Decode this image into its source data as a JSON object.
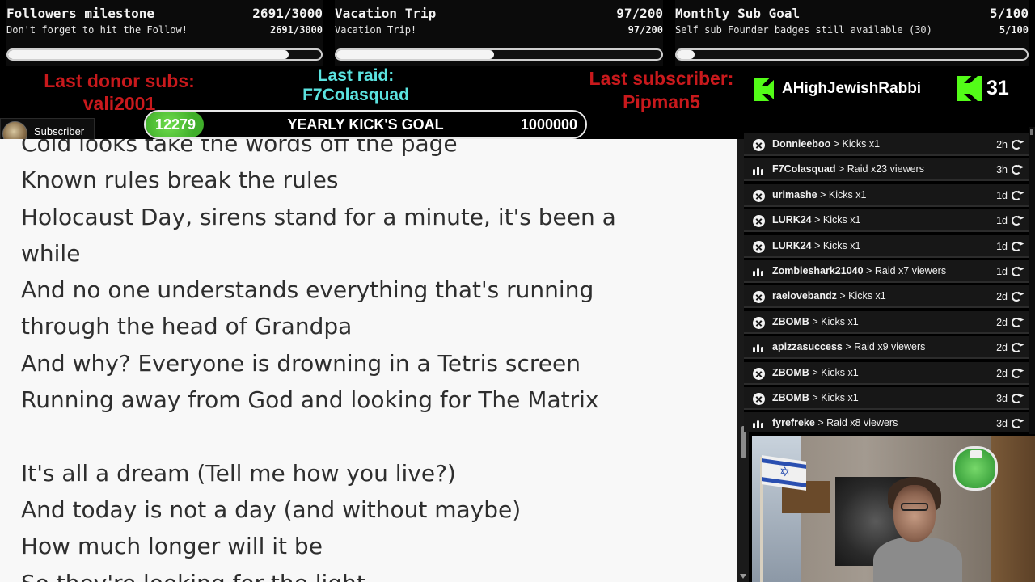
{
  "goals": [
    {
      "title": "Followers milestone",
      "count": "2691/3000",
      "subtitle": "Don't forget to hit the Follow!",
      "count_small": "2691/3000",
      "progress": 0.897
    },
    {
      "title": "Vacation Trip",
      "count": "97/200",
      "subtitle": "Vacation Trip!",
      "count_small": "97/200",
      "progress": 0.485
    },
    {
      "title": "Monthly Sub Goal",
      "count": "5/100",
      "subtitle": "Self sub Founder badges still available (30)",
      "count_small": "5/100",
      "progress": 0.05
    }
  ],
  "info": {
    "donor_title": "Last donor subs:",
    "donor_name": "vali2001",
    "raid_title": "Last raid:",
    "raid_name": "F7Colasquad",
    "subscriber_title": "Last subscriber:",
    "subscriber_name": "Pipman5",
    "latest_user": "AHighJewishRabbi",
    "kick_count": "31"
  },
  "yearly_goal": {
    "current": "12279",
    "title": "YEARLY KICK'S GOAL",
    "target": "1000000",
    "progress": 0.0123
  },
  "subscriber_badge": {
    "label": "Subscriber"
  },
  "lyrics": [
    "Cold looks take the words off the page",
    "Known rules break the rules",
    "Holocaust Day, sirens stand for a minute, it's been a",
    "while",
    "And no one understands everything that's running",
    "through the head of Grandpa",
    "And why? Everyone is drowning in a Tetris screen",
    "Running away from God and looking for The Matrix",
    "",
    "It's all a dream (Tell me how you live?)",
    "And today is not a day (and without maybe)",
    "How much longer will it be",
    "So they're looking for the light"
  ],
  "feed": [
    {
      "icon": "kick",
      "user": "Donnieeboo",
      "action": "Kicks x1",
      "time": "2h"
    },
    {
      "icon": "raid",
      "user": "F7Colasquad",
      "action": "Raid x23 viewers",
      "time": "3h"
    },
    {
      "icon": "kick",
      "user": "urimashe",
      "action": "Kicks x1",
      "time": "1d"
    },
    {
      "icon": "kick",
      "user": "LURK24",
      "action": "Kicks x1",
      "time": "1d"
    },
    {
      "icon": "kick",
      "user": "LURK24",
      "action": "Kicks x1",
      "time": "1d"
    },
    {
      "icon": "raid",
      "user": "Zombieshark21040",
      "action": "Raid x7 viewers",
      "time": "1d"
    },
    {
      "icon": "kick",
      "user": "raelovebandz",
      "action": "Kicks x1",
      "time": "2d"
    },
    {
      "icon": "kick",
      "user": "ZBOMB",
      "action": "Kicks x1",
      "time": "2d"
    },
    {
      "icon": "raid",
      "user": "apizzasuccess",
      "action": "Raid x9 viewers",
      "time": "2d"
    },
    {
      "icon": "kick",
      "user": "ZBOMB",
      "action": "Kicks x1",
      "time": "2d"
    },
    {
      "icon": "kick",
      "user": "ZBOMB",
      "action": "Kicks x1",
      "time": "3d"
    },
    {
      "icon": "raid",
      "user": "fyrefreke",
      "action": "Raid x8 viewers",
      "time": "3d"
    }
  ],
  "separator": ">",
  "colors": {
    "kick_green": "#53fc18",
    "alert_red": "#c8191c",
    "raid_teal": "#5be3e0"
  },
  "icons": {
    "kick": "kick-icon",
    "raid": "raid-icon",
    "replay": "replay-icon"
  }
}
